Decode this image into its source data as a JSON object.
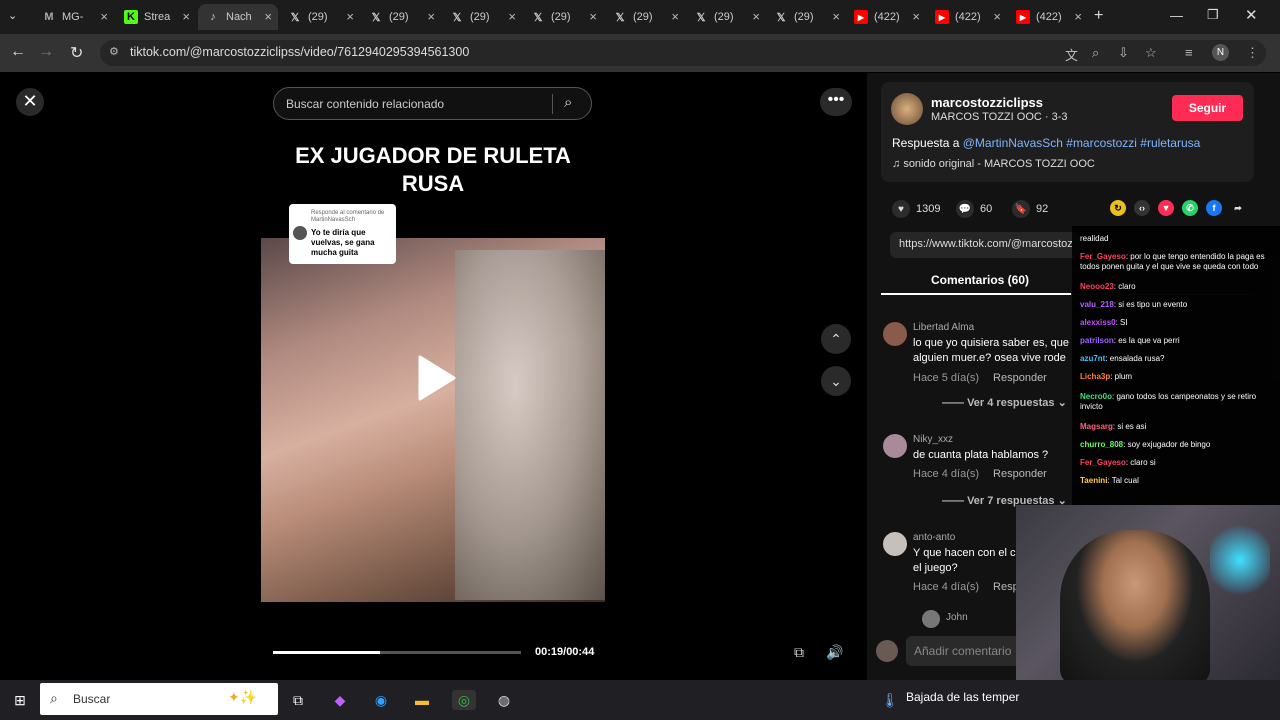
{
  "tabs": [
    "MG-",
    "Strea",
    "Nach",
    "(29)",
    "(29)",
    "(29)",
    "(29)",
    "(29)",
    "(29)",
    "(29)",
    "(422)",
    "(422)",
    "(422)"
  ],
  "url": "tiktok.com/@marcostozziclipss/video/7612940295394561300",
  "search_placeholder": "Buscar contenido relacionado",
  "video_title": "EX JUGADOR DE RULETA RUSA",
  "sticker_header": "Responde al comentario de MartinNavasSch",
  "sticker_text": "Yo te diría que vuelvas, se gana mucha guita",
  "progress": 0.43,
  "time": "00:19/00:44",
  "username": "marcostozziclipss",
  "nickname": "MARCOS TOZZI OOC · 3-3",
  "follow": "Seguir",
  "desc_prefix": "Respuesta a ",
  "desc_tags": "@MartinNavasSch #marcostozzi #ruletarusa",
  "sound": "sonido original - MARCOS TOZZI OOC",
  "likes": "1309",
  "comments_count": "60",
  "saves": "92",
  "link": "https://www.tiktok.com/@marcostoz",
  "comments_tab": "Comentarios (60)",
  "comments": [
    {
      "name": "Libertad Alma",
      "text": "lo que yo quisiera saber es, que alguien muer.e? osea vive rode",
      "meta": "Hace 5 día(s)",
      "reply": "Responder",
      "replies": "Ver 4 respuestas"
    },
    {
      "name": "Niky_xxz",
      "text": "de cuanta plata hablamos ?",
      "meta": "Hace 4 día(s)",
      "reply": "Responder",
      "replies": "Ver 7 respuestas"
    },
    {
      "name": "anto-anto",
      "text": "Y que hacen con el c el juego?",
      "meta": "Hace 4 día(s)",
      "reply": "Respon",
      "replies": ""
    }
  ],
  "sub_reply_name": "John",
  "add_comment": "Añadir comentario",
  "chat": [
    {
      "u": "",
      "m": "realidad",
      "c": "#fff"
    },
    {
      "u": "Fer_Gayeso",
      "m": ": por lo que tengo entendido la paga es todos ponen guita y el que vive se queda con todo",
      "c": "#ff4060"
    },
    {
      "u": "Neooo23",
      "m": ": claro",
      "c": "#ff4060"
    },
    {
      "u": "valu_218",
      "m": ": si es tipo un evento",
      "c": "#b060ff"
    },
    {
      "u": "alexxiss0",
      "m": ": SI",
      "c": "#c050ff"
    },
    {
      "u": "patrilson",
      "m": ": es la que va perri",
      "c": "#a060ff"
    },
    {
      "u": "azu7nt",
      "m": ": ensalada rusa?",
      "c": "#40c0ff"
    },
    {
      "u": "Licha3p",
      "m": ": plum",
      "c": "#ff8040"
    },
    {
      "u": "Necro0o",
      "m": ": gano todos los campeonatos y se retiro invicto",
      "c": "#40e080"
    },
    {
      "u": "Magsarg",
      "m": ": si es asi",
      "c": "#ff6080"
    },
    {
      "u": "churro_808",
      "m": ": soy exjugador de bingo",
      "c": "#60ff60"
    },
    {
      "u": "Fer_Gayeso",
      "m": ": claro si",
      "c": "#ff4060"
    },
    {
      "u": "Taenini",
      "m": ": Tal cual",
      "c": "#ffd040"
    }
  ],
  "taskbar_search": "Buscar",
  "weather": "Bajada de las temper"
}
